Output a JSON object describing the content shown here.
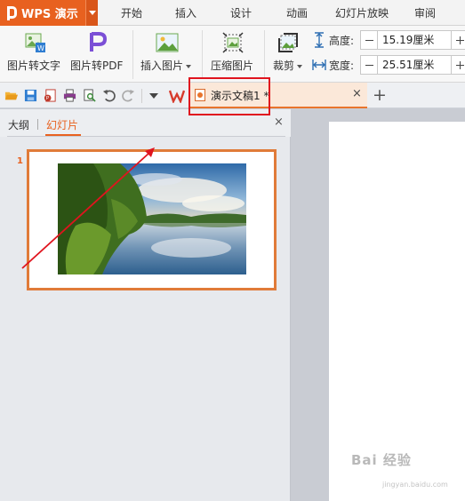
{
  "app": {
    "name": "WPS 演示"
  },
  "menu": [
    "开始",
    "插入",
    "设计",
    "动画",
    "幻灯片放映",
    "审阅"
  ],
  "ribbon": {
    "img_to_text": "图片转文字",
    "img_to_pdf": "图片转PDF",
    "insert_picture": "插入图片",
    "compress_picture": "压缩图片",
    "crop": "裁剪",
    "height_label": "高度:",
    "height_value": "15.19厘米",
    "width_label": "宽度:",
    "width_value": "25.51厘米"
  },
  "document_tab": {
    "title": "演示文稿1 *",
    "close": "×",
    "new_tab": "+"
  },
  "pane": {
    "tab_outline": "大纲",
    "tab_slides": "幻灯片",
    "close": "×",
    "slide_number": "1"
  },
  "watermark": {
    "text": "Bai 经验",
    "sub": "jingyan.baidu.com"
  },
  "colors": {
    "accent": "#e8611f",
    "highlight_box": "#e0141e",
    "arrow": "#e0141e"
  }
}
